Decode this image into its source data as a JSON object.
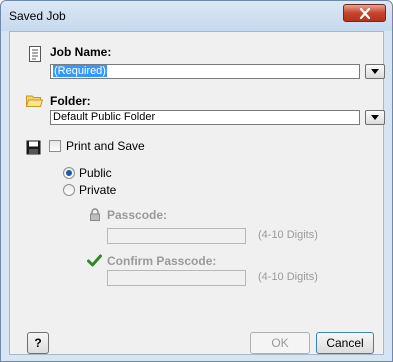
{
  "window": {
    "title": "Saved Job",
    "close_glyph": "x"
  },
  "job_name": {
    "label": "Job Name:",
    "value": "(Required)",
    "icon": "document-icon"
  },
  "folder": {
    "label": "Folder:",
    "value": "Default Public Folder",
    "icon": "folder-icon"
  },
  "print_and_save": {
    "label": "Print and Save",
    "checked": false,
    "icon": "floppy-disk-icon"
  },
  "visibility": {
    "selected": "Public",
    "options": [
      "Public",
      "Private"
    ]
  },
  "passcode": {
    "label": "Passcode:",
    "hint": "(4-10 Digits)",
    "value": "",
    "icon": "lock-icon"
  },
  "confirm_passcode": {
    "label": "Confirm Passcode:",
    "hint": "(4-10 Digits)",
    "value": "",
    "icon": "checkmark-icon"
  },
  "buttons": {
    "help": "?",
    "ok": "OK",
    "cancel": "Cancel"
  },
  "colors": {
    "selection": "#3399ff",
    "close_button": "#c7442c",
    "checkmark": "#2e8b22"
  }
}
